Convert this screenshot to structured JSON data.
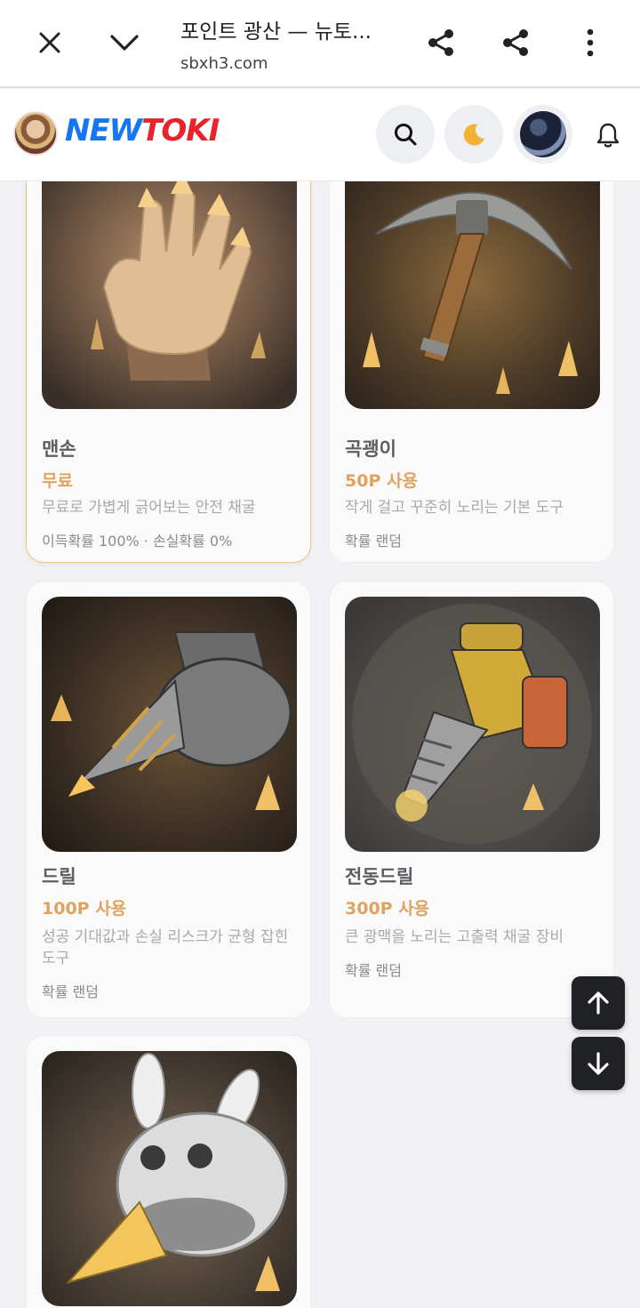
{
  "browser": {
    "title": "포인트 광산 — 뉴토...",
    "url": "sbxh3.com",
    "icons": [
      "close-icon",
      "chevron-down-icon",
      "share-icon",
      "share-icon",
      "more-vert-icon"
    ]
  },
  "site": {
    "logo_part1": "NEW",
    "logo_part2": "TOKI",
    "icons": [
      "search-icon",
      "moon-icon",
      "bell-icon"
    ]
  },
  "tools": [
    {
      "name": "맨손",
      "price": "무료",
      "desc": "무료로 가볍게 긁어보는 안전 채굴",
      "prob": "이득확률 100% · 손실확률 0%",
      "selected": true,
      "image": "glowing-crystal-hand"
    },
    {
      "name": "곡괭이",
      "price": "50P 사용",
      "desc": "작게 걸고 꾸준히 노리는 기본 도구",
      "prob": "확률 랜덤",
      "selected": false,
      "image": "pickaxe"
    },
    {
      "name": "드릴",
      "price": "100P 사용",
      "desc": "성공 기대값과 손실 리스크가 균형 잡힌 도구",
      "prob": "확률 랜덤",
      "selected": false,
      "image": "drill"
    },
    {
      "name": "전동드릴",
      "price": "300P 사용",
      "desc": "큰 광맥을 노리는 고출력 채굴 장비",
      "prob": "확률 랜덤",
      "selected": false,
      "image": "power-drill"
    },
    {
      "name": "",
      "price": "",
      "desc": "",
      "prob": "",
      "selected": false,
      "image": "rabbit-drill"
    }
  ],
  "fabs": [
    "arrow-up-icon",
    "arrow-down-icon"
  ],
  "colors": {
    "price": "#e0a35f",
    "selected_border": "#f0c27b",
    "accent_blue": "#1676f0",
    "accent_red": "#e8232c"
  }
}
